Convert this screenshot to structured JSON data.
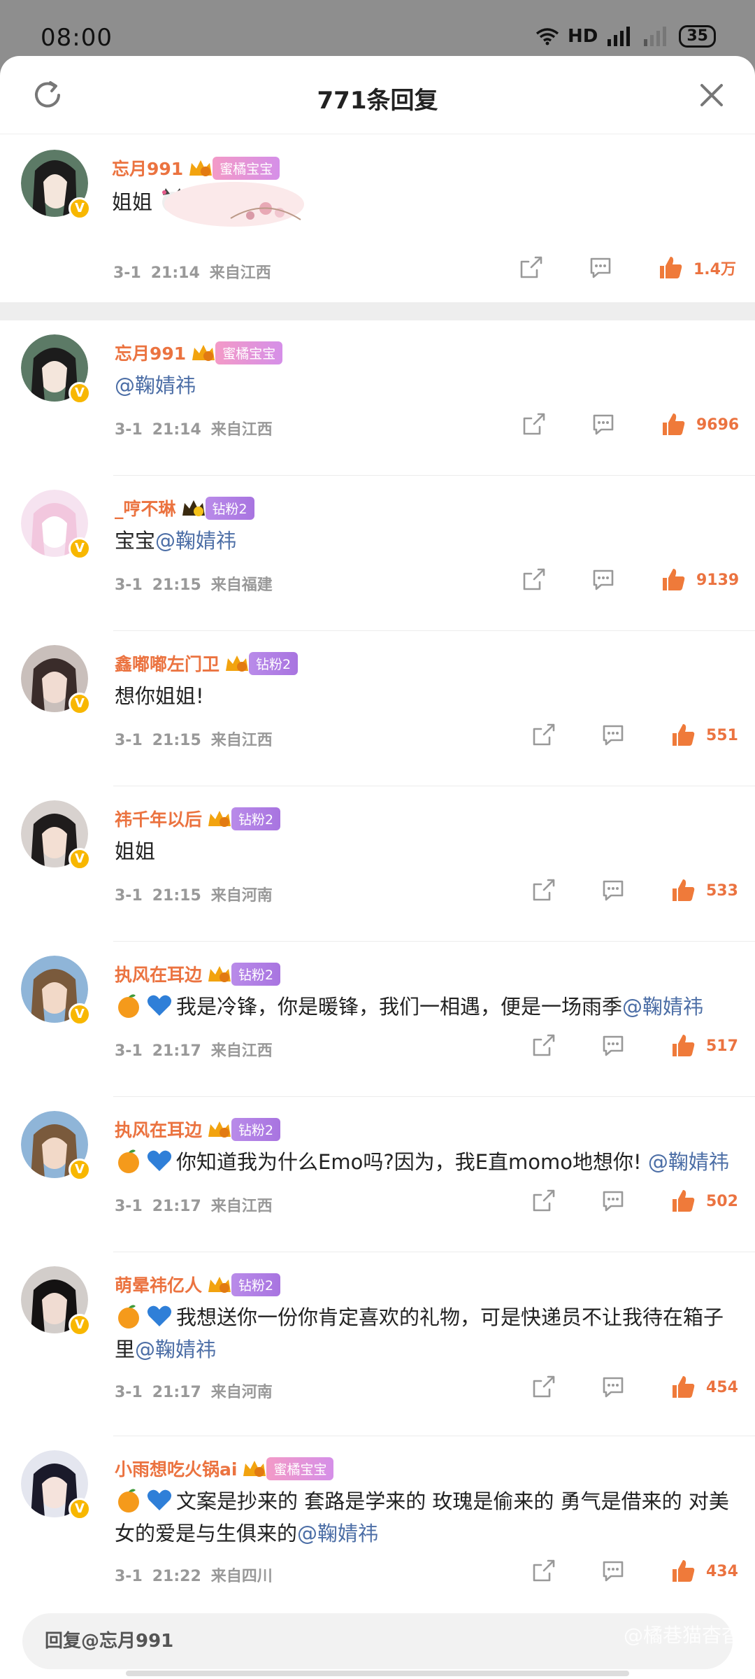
{
  "status_bar": {
    "time": "08:00",
    "network": "HD",
    "battery": "35"
  },
  "sheet": {
    "title": "771条回复",
    "refresh_icon": "refresh-icon",
    "close_icon": "close-icon"
  },
  "colors": {
    "accent": "#eb7340",
    "mention": "#4c6ea6",
    "meta": "#999999",
    "verified": "#f8b700"
  },
  "root_comment": {
    "username": "忘月991",
    "badge": "蜜橘宝宝",
    "badge_level": "6",
    "text": "姐姐",
    "date": "3-1",
    "time": "21:14",
    "location": "来自江西",
    "likes": "1.4万"
  },
  "replies": [
    {
      "username": "忘月991",
      "badge": "蜜橘宝宝",
      "badge_level": "6",
      "text_prefix": "",
      "mention": "@鞠婧祎",
      "text_suffix": "",
      "date": "3-1",
      "time": "21:14",
      "location": "来自江西",
      "likes": "9696"
    },
    {
      "username": "_哼不琳",
      "badge": "钻粉2",
      "badge_level": "",
      "text_prefix": "宝宝",
      "mention": "@鞠婧祎",
      "text_suffix": "",
      "date": "3-1",
      "time": "21:15",
      "location": "来自福建",
      "likes": "9139"
    },
    {
      "username": "鑫嘟嘟左门卫",
      "badge": "钻粉2",
      "badge_level": "4",
      "text_prefix": "想你姐姐!",
      "mention": "",
      "text_suffix": "",
      "date": "3-1",
      "time": "21:15",
      "location": "来自江西",
      "likes": "551"
    },
    {
      "username": "祎千年以后",
      "badge": "钻粉2",
      "badge_level": "4",
      "text_prefix": "姐姐",
      "mention": "",
      "text_suffix": "",
      "date": "3-1",
      "time": "21:15",
      "location": "来自河南",
      "likes": "533"
    },
    {
      "username": "执风在耳边",
      "badge": "钻粉2",
      "badge_level": "3",
      "text_prefix": "我是冷锋，你是暖锋，我们一相遇，便是一场雨季",
      "mention": "@鞠婧祎",
      "text_suffix": "",
      "date": "3-1",
      "time": "21:17",
      "location": "来自江西",
      "likes": "517"
    },
    {
      "username": "执风在耳边",
      "badge": "钻粉2",
      "badge_level": "3",
      "text_prefix": "你知道我为什么Emo吗?因为，我E直momo地想你! ",
      "mention": "@鞠婧祎",
      "text_suffix": "",
      "date": "3-1",
      "time": "21:17",
      "location": "来自江西",
      "likes": "502"
    },
    {
      "username": "萌晕祎亿人",
      "badge": "钻粉2",
      "badge_level": "5",
      "text_prefix": "我想送你一份你肯定喜欢的礼物，可是快递员不让我待在箱子里",
      "mention": "@鞠婧祎",
      "text_suffix": "",
      "date": "3-1",
      "time": "21:17",
      "location": "来自河南",
      "likes": "454"
    },
    {
      "username": "小雨想吃火锅ai",
      "badge": "蜜橘宝宝",
      "badge_level": "6",
      "text_prefix": "文案是抄来的  套路是学来的  玫瑰是偷来的  勇气是借来的 对美女的爱是与生俱来的",
      "mention": "@鞠婧祎",
      "text_suffix": "",
      "date": "3-1",
      "time": "21:22",
      "location": "来自四川",
      "likes": "434"
    }
  ],
  "reply_bar": {
    "placeholder": "回复@忘月991"
  },
  "watermark": "@橘巷猫杳杳"
}
